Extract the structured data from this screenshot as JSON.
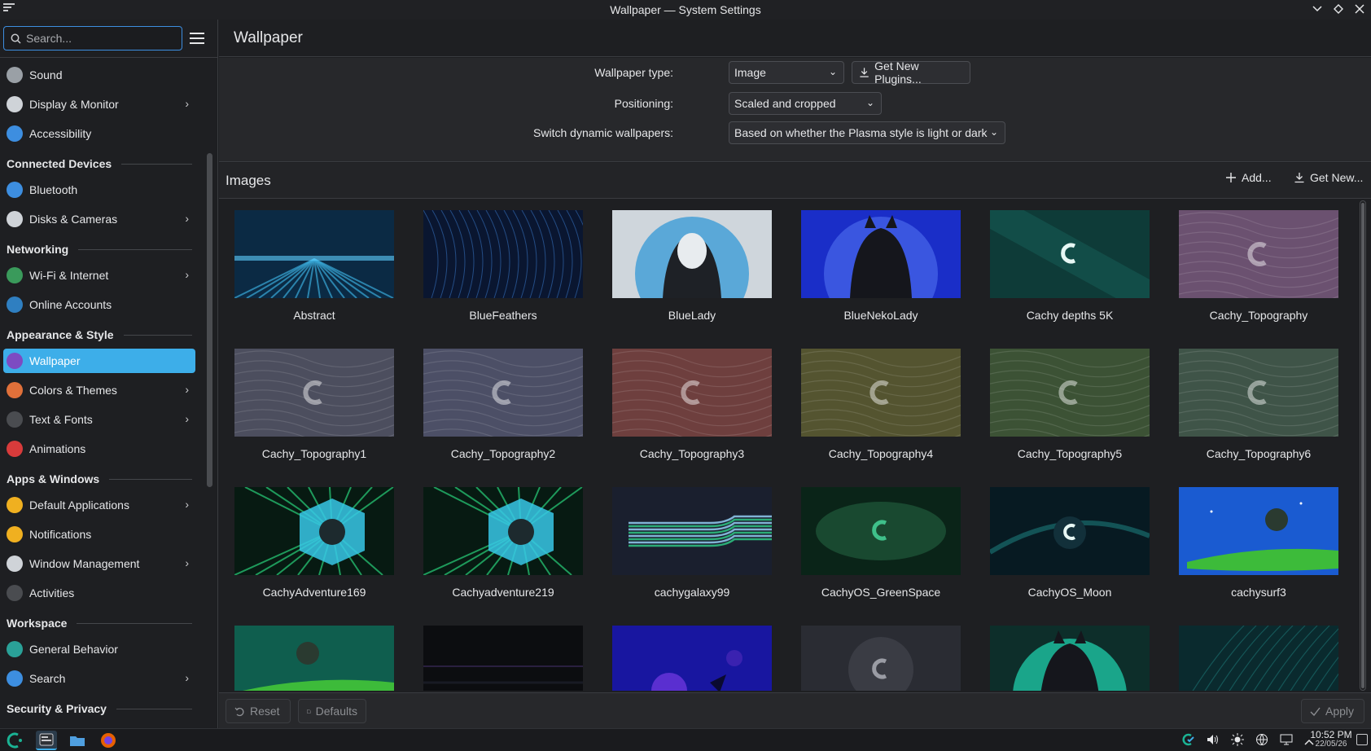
{
  "window": {
    "title": "Wallpaper — System Settings",
    "controls": [
      "minimize",
      "maximize",
      "close"
    ]
  },
  "sidebar": {
    "search_placeholder": "Search...",
    "items": [
      {
        "kind": "item",
        "label": "Sound",
        "icon": "sound-icon",
        "color": "#9aa0a6",
        "chevron": false
      },
      {
        "kind": "item",
        "label": "Display & Monitor",
        "icon": "monitor-icon",
        "color": "#cfd3d8",
        "chevron": true
      },
      {
        "kind": "item",
        "label": "Accessibility",
        "icon": "accessibility-icon",
        "color": "#3d8ee0",
        "chevron": false
      },
      {
        "kind": "group",
        "label": "Connected Devices"
      },
      {
        "kind": "item",
        "label": "Bluetooth",
        "icon": "bluetooth-icon",
        "color": "#3d8ee0",
        "chevron": false
      },
      {
        "kind": "item",
        "label": "Disks & Cameras",
        "icon": "disk-icon",
        "color": "#cfd3d8",
        "chevron": true
      },
      {
        "kind": "group",
        "label": "Networking"
      },
      {
        "kind": "item",
        "label": "Wi-Fi & Internet",
        "icon": "globe-icon",
        "color": "#3a9a5b",
        "chevron": true
      },
      {
        "kind": "item",
        "label": "Online Accounts",
        "icon": "online-accounts-icon",
        "color": "#2f7fc1",
        "chevron": false
      },
      {
        "kind": "group",
        "label": "Appearance & Style"
      },
      {
        "kind": "item",
        "label": "Wallpaper",
        "icon": "wallpaper-icon",
        "color": "#7d4bc2",
        "chevron": false,
        "active": true
      },
      {
        "kind": "item",
        "label": "Colors & Themes",
        "icon": "palette-icon",
        "color": "#e0703a",
        "chevron": true
      },
      {
        "kind": "item",
        "label": "Text & Fonts",
        "icon": "font-icon",
        "color": "#4a4c50",
        "chevron": true
      },
      {
        "kind": "item",
        "label": "Animations",
        "icon": "animations-icon",
        "color": "#d83b3b",
        "chevron": false
      },
      {
        "kind": "group",
        "label": "Apps & Windows"
      },
      {
        "kind": "item",
        "label": "Default Applications",
        "icon": "star-icon",
        "color": "#f0b020",
        "chevron": true
      },
      {
        "kind": "item",
        "label": "Notifications",
        "icon": "bell-icon",
        "color": "#f0b020",
        "chevron": false
      },
      {
        "kind": "item",
        "label": "Window Management",
        "icon": "window-icon",
        "color": "#cfd3d8",
        "chevron": true
      },
      {
        "kind": "item",
        "label": "Activities",
        "icon": "activities-icon",
        "color": "#4a4c50",
        "chevron": false
      },
      {
        "kind": "group",
        "label": "Workspace"
      },
      {
        "kind": "item",
        "label": "General Behavior",
        "icon": "general-behavior-icon",
        "color": "#2aa198",
        "chevron": false
      },
      {
        "kind": "item",
        "label": "Search",
        "icon": "search-icon",
        "color": "#3d8ee0",
        "chevron": true
      },
      {
        "kind": "group",
        "label": "Security & Privacy"
      }
    ]
  },
  "page": {
    "title": "Wallpaper",
    "form": {
      "type_label": "Wallpaper type:",
      "type_value": "Image",
      "get_plugins": "Get New Plugins...",
      "positioning_label": "Positioning:",
      "positioning_value": "Scaled and cropped",
      "dynamic_label": "Switch dynamic wallpapers:",
      "dynamic_value": "Based on whether the Plasma style is light or dark"
    },
    "images": {
      "title": "Images",
      "add": "Add...",
      "get_new": "Get New..."
    },
    "wallpapers": [
      {
        "name": "Abstract",
        "style": "abstract"
      },
      {
        "name": "BlueFeathers",
        "style": "feathers"
      },
      {
        "name": "BlueLady",
        "style": "bluelady"
      },
      {
        "name": "BlueNekoLady",
        "style": "neko"
      },
      {
        "name": "Cachy depths 5K",
        "style": "depths"
      },
      {
        "name": "Cachy_Topography",
        "style": "topo",
        "color": "#6b5170"
      },
      {
        "name": "Cachy_Topography1",
        "style": "topo",
        "color": "#4c4e5e"
      },
      {
        "name": "Cachy_Topography2",
        "style": "topo",
        "color": "#4c4f66"
      },
      {
        "name": "Cachy_Topography3",
        "style": "topo",
        "color": "#6e3f3e"
      },
      {
        "name": "Cachy_Topography4",
        "style": "topo",
        "color": "#545430"
      },
      {
        "name": "Cachy_Topography5",
        "style": "topo",
        "color": "#3c5235"
      },
      {
        "name": "Cachy_Topography6",
        "style": "topo",
        "color": "#3f5448"
      },
      {
        "name": "CachyAdventure169",
        "style": "adventure"
      },
      {
        "name": "Cachyadventure219",
        "style": "adventure"
      },
      {
        "name": "cachygalaxy99",
        "style": "galaxy"
      },
      {
        "name": "CachyOS_GreenSpace",
        "style": "greenspace"
      },
      {
        "name": "CachyOS_Moon",
        "style": "moon"
      },
      {
        "name": "cachysurf3",
        "style": "surf"
      },
      {
        "name": "",
        "style": "surf2"
      },
      {
        "name": "",
        "style": "dark"
      },
      {
        "name": "",
        "style": "planets"
      },
      {
        "name": "",
        "style": "grey"
      },
      {
        "name": "",
        "style": "greenlady"
      },
      {
        "name": "",
        "style": "teal"
      }
    ],
    "footer": {
      "reset": "Reset",
      "defaults": "Defaults",
      "apply": "Apply"
    }
  },
  "taskbar": {
    "time": "10:52 PM",
    "date": "22/05/26"
  }
}
